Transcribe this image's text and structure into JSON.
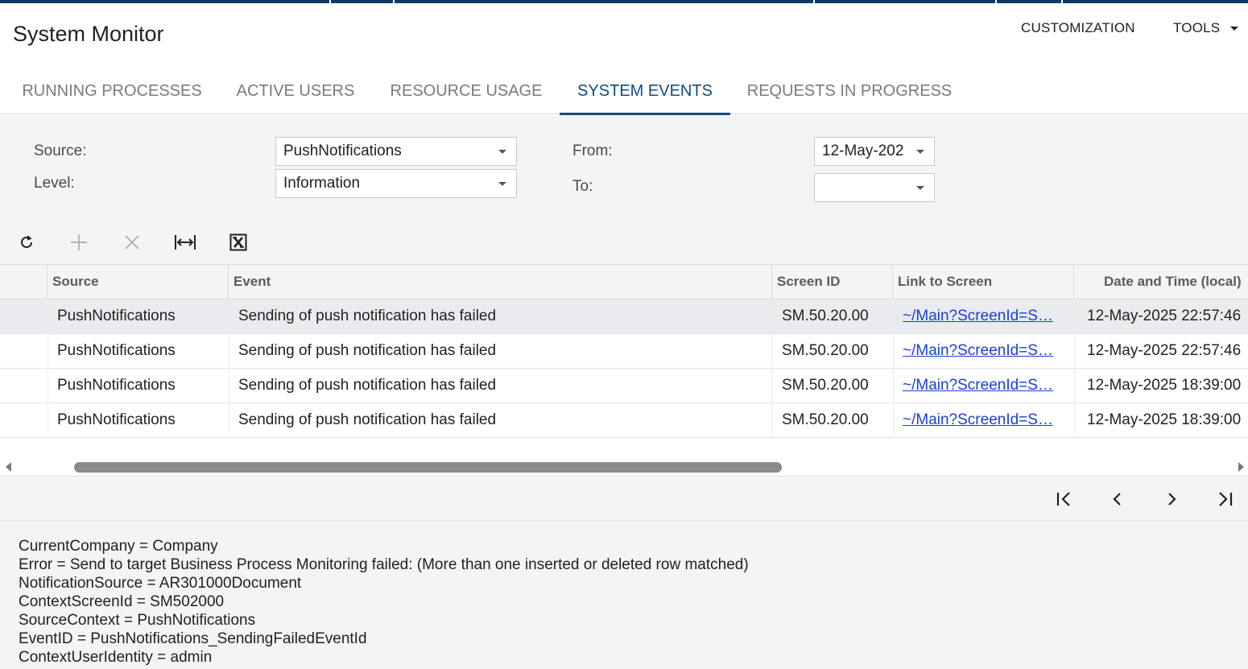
{
  "header": {
    "title": "System Monitor",
    "menu": {
      "customization": "CUSTOMIZATION",
      "tools": "TOOLS"
    }
  },
  "tabs": [
    {
      "label": "RUNNING PROCESSES",
      "active": false
    },
    {
      "label": "ACTIVE USERS",
      "active": false
    },
    {
      "label": "RESOURCE USAGE",
      "active": false
    },
    {
      "label": "SYSTEM EVENTS",
      "active": true
    },
    {
      "label": "REQUESTS IN PROGRESS",
      "active": false
    }
  ],
  "filters": {
    "source": {
      "label": "Source:",
      "value": "PushNotifications"
    },
    "level": {
      "label": "Level:",
      "value": "Information"
    },
    "from": {
      "label": "From:",
      "value": "12-May-202"
    },
    "to": {
      "label": "To:",
      "value": ""
    }
  },
  "toolbar": {
    "refresh": "refresh-icon",
    "add": "plus-icon",
    "delete": "close-icon",
    "fit": "fit-columns-icon",
    "export": "excel-export-icon"
  },
  "grid": {
    "columns": [
      "Source",
      "Event",
      "Screen ID",
      "Link to Screen",
      "Date and Time (local)"
    ],
    "rows": [
      {
        "source": "PushNotifications",
        "event": "Sending of push notification has failed",
        "screen_id": "SM.50.20.00",
        "link": "~/Main?ScreenId=S…",
        "datetime": "12-May-2025 22:57:46",
        "selected": true
      },
      {
        "source": "PushNotifications",
        "event": "Sending of push notification has failed",
        "screen_id": "SM.50.20.00",
        "link": "~/Main?ScreenId=S…",
        "datetime": "12-May-2025 22:57:46",
        "selected": false
      },
      {
        "source": "PushNotifications",
        "event": "Sending of push notification has failed",
        "screen_id": "SM.50.20.00",
        "link": "~/Main?ScreenId=S…",
        "datetime": "12-May-2025 18:39:00",
        "selected": false
      },
      {
        "source": "PushNotifications",
        "event": "Sending of push notification has failed",
        "screen_id": "SM.50.20.00",
        "link": "~/Main?ScreenId=S…",
        "datetime": "12-May-2025 18:39:00",
        "selected": false
      }
    ]
  },
  "details": [
    "CurrentCompany = Company",
    "Error = Send to target Business Process Monitoring failed: (More than one inserted or deleted row matched)",
    "NotificationSource = AR301000Document",
    "ContextScreenId = SM502000",
    "SourceContext = PushNotifications",
    "EventID = PushNotifications_SendingFailedEventId",
    "ContextUserIdentity = admin"
  ],
  "colors": {
    "accent": "#0f4c81",
    "topbar": "#0c3a63",
    "link": "#1b3fd6",
    "panel": "#f3f4f5"
  }
}
